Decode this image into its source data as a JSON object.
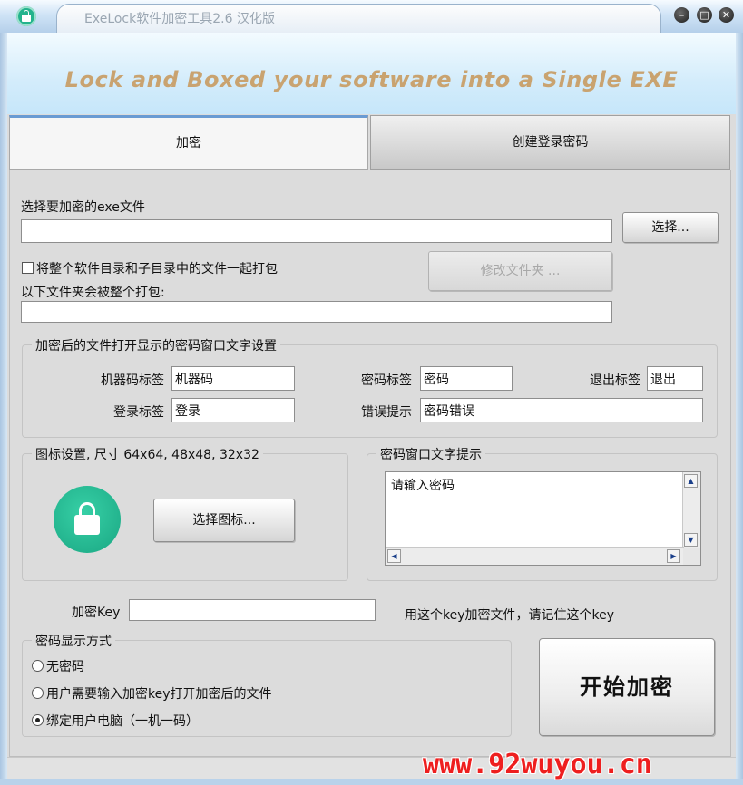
{
  "window": {
    "title": "ExeLock软件加密工具2.6 汉化版",
    "banner": "Lock and Boxed your software into a Single EXE"
  },
  "tabs": [
    {
      "label": "加密",
      "active": true
    },
    {
      "label": "创建登录密码",
      "active": false
    }
  ],
  "file": {
    "label": "选择要加密的exe文件",
    "value": "",
    "browse_label": "选择..."
  },
  "pack": {
    "checkbox_label": "将整个软件目录和子目录中的文件一起打包",
    "checked": false,
    "folder_button": "修改文件夹 ...",
    "folder_label": "以下文件夹会被整个打包:",
    "folder_value": ""
  },
  "password_window": {
    "group_title": "加密后的文件打开显示的密码窗口文字设置",
    "machine_code_label": "机器码标签",
    "machine_code_value": "机器码",
    "password_label": "密码标签",
    "password_value": "密码",
    "exit_label": "退出标签",
    "exit_value": "退出",
    "login_label": "登录标签",
    "login_value": "登录",
    "error_label": "错误提示",
    "error_value": "密码错误"
  },
  "icon_settings": {
    "group_title": "图标设置, 尺寸 64x64, 48x48, 32x32",
    "icon_name": "lock-icon",
    "choose_button": "选择图标..."
  },
  "prompt": {
    "group_title": "密码窗口文字提示",
    "text": "请输入密码"
  },
  "key": {
    "label": "加密Key",
    "value": "",
    "hint": "用这个key加密文件，请记住这个key"
  },
  "display_mode": {
    "group_title": "密码显示方式",
    "options": [
      {
        "label": "无密码",
        "selected": false
      },
      {
        "label": "用户需要输入加密key打开加密后的文件",
        "selected": false
      },
      {
        "label": "绑定用户电脑（一机一码）",
        "selected": true
      }
    ]
  },
  "start_button": "开始加密",
  "watermark": "www.92wuyou.cn",
  "colors": {
    "accent": "#6a9bd3",
    "slogan": "#c9a370",
    "icon_green": "#1aa783",
    "watermark": "#ee1f1f"
  }
}
